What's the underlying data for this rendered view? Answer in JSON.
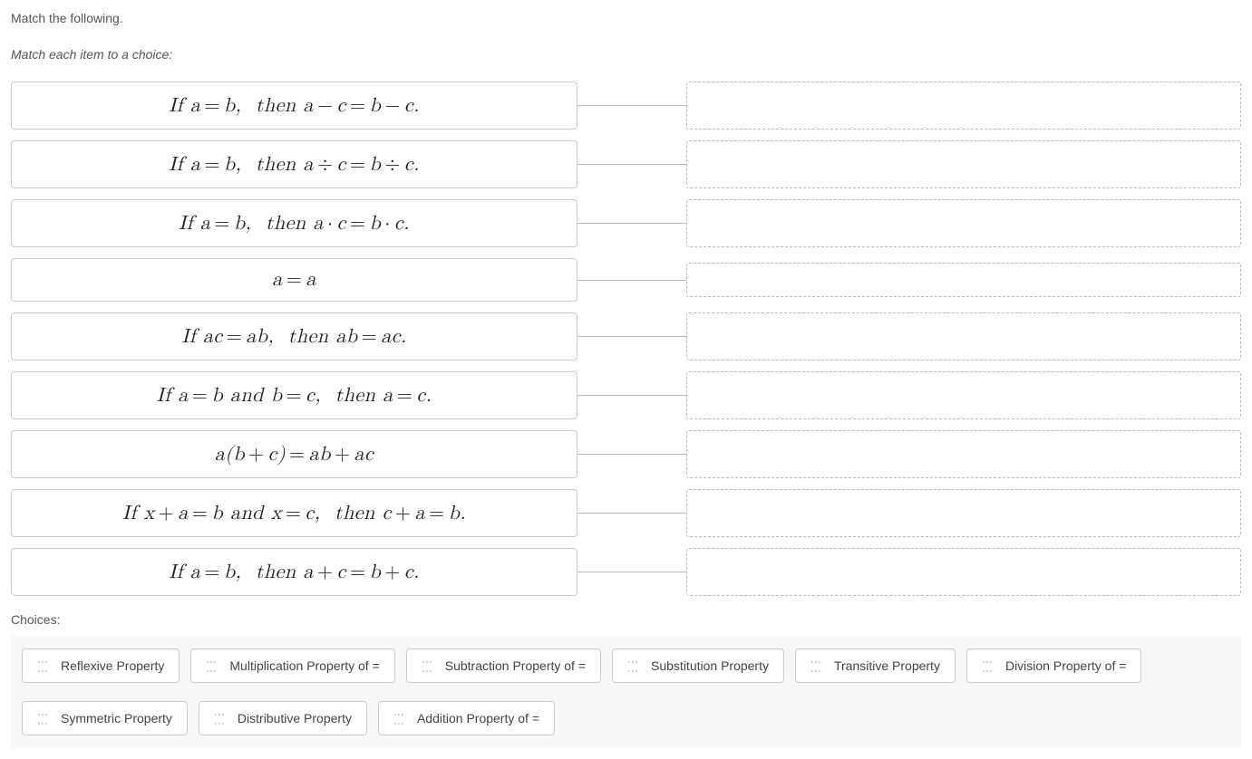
{
  "heading": "Match the following.",
  "subheading": "Match each item to a choice:",
  "items": [
    {
      "expr_html": "<span class='mi'>If a</span><span class='op'>=</span><span class='mi'>b</span>,&nbsp;&nbsp;<span class='mi'>then a</span><span class='op'>−</span><span class='mi'>c</span><span class='op'>=</span><span class='mi'>b</span><span class='op'>−</span><span class='mi'>c</span>.",
      "short": false
    },
    {
      "expr_html": "<span class='mi'>If a</span><span class='op'>=</span><span class='mi'>b</span>,&nbsp;&nbsp;<span class='mi'>then a</span><span class='op'>÷</span><span class='mi'>c</span><span class='op'>=</span><span class='mi'>b</span><span class='op'>÷</span><span class='mi'>c</span>.",
      "short": false
    },
    {
      "expr_html": "<span class='mi'>If a</span><span class='op'>=</span><span class='mi'>b</span>,&nbsp;&nbsp;<span class='mi'>then a</span><span class='op'>·</span><span class='mi'>c</span><span class='op'>=</span><span class='mi'>b</span><span class='op'>·</span><span class='mi'>c</span>.",
      "short": false
    },
    {
      "expr_html": "<span class='mi'>a</span><span class='op'>=</span><span class='mi'>a</span>",
      "short": true
    },
    {
      "expr_html": "<span class='mi'>If ac</span><span class='op'>=</span><span class='mi'>ab</span>,&nbsp;&nbsp;<span class='mi'>then ab</span><span class='op'>=</span><span class='mi'>ac</span>.",
      "short": false
    },
    {
      "expr_html": "<span class='mi'>If a</span><span class='op'>=</span><span class='mi'>b and b</span><span class='op'>=</span><span class='mi'>c</span>,&nbsp;&nbsp;<span class='mi'>then a</span><span class='op'>=</span><span class='mi'>c</span>.",
      "short": false
    },
    {
      "expr_html": "<span class='mi'>a</span>(<span class='mi'>b</span><span class='op'>+</span><span class='mi'>c</span>)<span class='op'>=</span><span class='mi'>ab</span><span class='op'>+</span><span class='mi'>ac</span>",
      "short": false
    },
    {
      "expr_html": "<span class='mi'>If x</span><span class='op'>+</span><span class='mi'>a</span><span class='op'>=</span><span class='mi'>b and x</span><span class='op'>=</span><span class='mi'>c</span>,&nbsp;&nbsp;<span class='mi'>then c</span><span class='op'>+</span><span class='mi'>a</span><span class='op'>=</span><span class='mi'>b</span>.",
      "short": false
    },
    {
      "expr_html": "<span class='mi'>If a</span><span class='op'>=</span><span class='mi'>b</span>,&nbsp;&nbsp;<span class='mi'>then a</span><span class='op'>+</span><span class='mi'>c</span><span class='op'>=</span><span class='mi'>b</span><span class='op'>+</span><span class='mi'>c</span>.",
      "short": false
    }
  ],
  "choices_label": "Choices:",
  "choices": [
    "Reflexive Property",
    "Multiplication Property of =",
    "Subtraction Property of =",
    "Substitution Property",
    "Transitive Property",
    "Division Property of =",
    "Symmetric Property",
    "Distributive Property",
    "Addition Property of ="
  ]
}
